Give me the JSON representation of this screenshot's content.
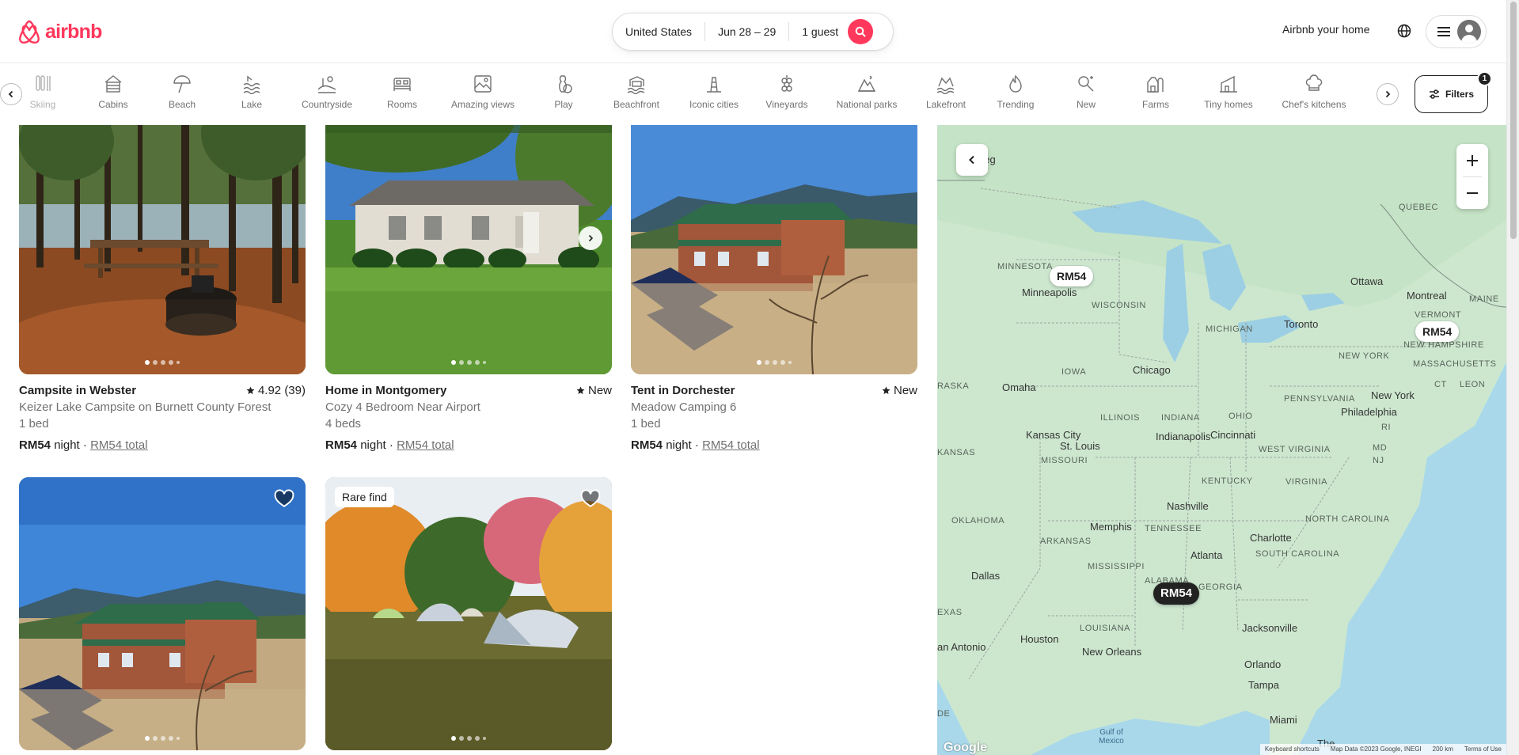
{
  "brand": {
    "name": "airbnb",
    "color": "#FF385C"
  },
  "search": {
    "location": "United States",
    "dates": "Jun 28 – 29",
    "guests": "1 guest"
  },
  "header": {
    "host_link": "Airbnb your home"
  },
  "categories": [
    {
      "label": "Skiing",
      "icon": "skiing-icon"
    },
    {
      "label": "Cabins",
      "icon": "cabin-icon"
    },
    {
      "label": "Beach",
      "icon": "umbrella-icon"
    },
    {
      "label": "Lake",
      "icon": "lake-icon"
    },
    {
      "label": "Countryside",
      "icon": "countryside-icon"
    },
    {
      "label": "Rooms",
      "icon": "bed-icon"
    },
    {
      "label": "Amazing views",
      "icon": "picture-icon"
    },
    {
      "label": "Play",
      "icon": "bowling-icon"
    },
    {
      "label": "Beachfront",
      "icon": "beachfront-icon"
    },
    {
      "label": "Iconic cities",
      "icon": "tower-icon"
    },
    {
      "label": "Vineyards",
      "icon": "grapes-icon"
    },
    {
      "label": "National parks",
      "icon": "park-icon"
    },
    {
      "label": "Lakefront",
      "icon": "lakefront-icon"
    },
    {
      "label": "Trending",
      "icon": "flame-icon"
    },
    {
      "label": "New",
      "icon": "sparkle-key-icon"
    },
    {
      "label": "Farms",
      "icon": "barn-icon"
    },
    {
      "label": "Tiny homes",
      "icon": "tiny-home-icon"
    },
    {
      "label": "Chef's kitchens",
      "icon": "chef-hat-icon"
    }
  ],
  "filters": {
    "label": "Filters",
    "count": "1"
  },
  "listings": [
    {
      "title": "Campsite in Webster",
      "rating": "4.92 (39)",
      "subtitle": "Keizer Lake Campsite on Burnett County Forest",
      "detail": "1 bed",
      "price": "RM54",
      "night": "night",
      "sep": "·",
      "total": "RM54 total"
    },
    {
      "title": "Home in Montgomery",
      "rating": "New",
      "subtitle": "Cozy 4 Bedroom Near Airport",
      "detail": "4 beds",
      "price": "RM54",
      "night": "night",
      "sep": "·",
      "total": "RM54 total"
    },
    {
      "title": "Tent in Dorchester",
      "rating": "New",
      "subtitle": "Meadow Camping 6",
      "detail": "1 bed",
      "price": "RM54",
      "night": "night",
      "sep": "·",
      "total": "RM54 total"
    },
    {
      "badge": ""
    },
    {
      "badge": "Rare find"
    }
  ],
  "map": {
    "pins": [
      "RM54",
      "RM54",
      "RM54"
    ],
    "states": [
      "MINNESOTA",
      "WISCONSIN",
      "MICHIGAN",
      "IOWA",
      "ILLINOIS",
      "INDIANA",
      "OHIO",
      "PENNSYLVANIA",
      "NEW YORK",
      "VERMONT",
      "NEW HAMPSHIRE",
      "MASSACHUSETTS",
      "MAINE",
      "QUEBEC",
      "KANSAS",
      "MISSOURI",
      "KENTUCKY",
      "WEST VIRGINIA",
      "VIRGINIA",
      "TENNESSEE",
      "NORTH CAROLINA",
      "SOUTH CAROLINA",
      "GEORGIA",
      "ALABAMA",
      "MISSISSIPPI",
      "ARKANSAS",
      "OKLAHOMA",
      "LOUISIANA",
      "EXAS",
      "RASKA",
      "LEON",
      "CT",
      "RI",
      "NJ",
      "DE",
      "MD"
    ],
    "cities": [
      "peg",
      "Minneapolis",
      "Ottawa",
      "Montreal",
      "Toronto",
      "Chicago",
      "Omaha",
      "Indianapolis",
      "Cincinnati",
      "Kansas City",
      "St. Louis",
      "New York",
      "Philadelphia",
      "Nashville",
      "Memphis",
      "Charlotte",
      "Atlanta",
      "Dallas",
      "Houston",
      "New Orleans",
      "Jacksonville",
      "Orlando",
      "Tampa",
      "Miami",
      "an Antonio",
      "The"
    ],
    "water": [
      "Gulf of Mexico"
    ],
    "attribution": [
      "Google",
      "Keyboard shortcuts",
      "Map Data ©2023 Google, INEGI",
      "200 km",
      "Terms of Use"
    ]
  }
}
